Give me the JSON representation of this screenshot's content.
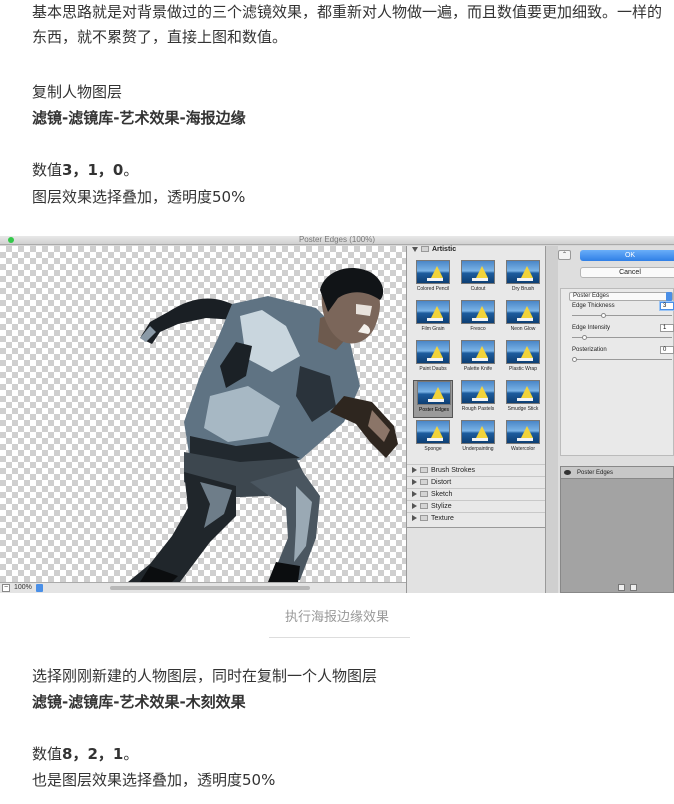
{
  "article": {
    "intro": "基本思路就是对背景做过的三个滤镜效果，都重新对人物做一遍，而且数值要更加细致。一样的东西，就不累赘了，直接上图和数值。",
    "step1_action": "复制人物图层",
    "step1_path": "滤镜-滤镜库-艺术效果-海报边缘",
    "step1_values_prefix": "数值",
    "step1_values": "3，1，0",
    "step1_values_suffix": "。",
    "step1_blend": "图层效果选择叠加，透明度50%",
    "caption": "执行海报边缘效果",
    "step2_action": "选择刚刚新建的人物图层，同时在复制一个人物图层",
    "step2_path": "滤镜-滤镜库-艺术效果-木刻效果",
    "step2_values_prefix": "数值",
    "step2_values": "8，2，1",
    "step2_values_suffix": "。",
    "step2_blend": "也是图层效果选择叠加，透明度50%"
  },
  "screenshot": {
    "window_title": "Poster Edges (100%)",
    "zoom": "100%",
    "zoom_minus": "−",
    "category_open": "Artistic",
    "filters": [
      "Colored Pencil",
      "Cutout",
      "Dry Brush",
      "Film Grain",
      "Fresco",
      "Neon Glow",
      "Paint Daubs",
      "Palette Knife",
      "Plastic Wrap",
      "Poster Edges",
      "Rough Pastels",
      "Smudge Stick",
      "Sponge",
      "Underpainting",
      "Watercolor"
    ],
    "selected_filter": "Poster Edges",
    "categories_closed": [
      "Brush Strokes",
      "Distort",
      "Sketch",
      "Stylize",
      "Texture"
    ],
    "ok_label": "OK",
    "cancel_label": "Cancel",
    "collapse_glyph": "⌃",
    "filter_select": "Poster Edges",
    "params": [
      {
        "label": "Edge Thickness",
        "value": "3",
        "fraction": 0.3
      },
      {
        "label": "Edge Intensity",
        "value": "1",
        "fraction": 0.1
      },
      {
        "label": "Posterization",
        "value": "0",
        "fraction": 0.0
      }
    ],
    "layer_name": "Poster Edges"
  }
}
